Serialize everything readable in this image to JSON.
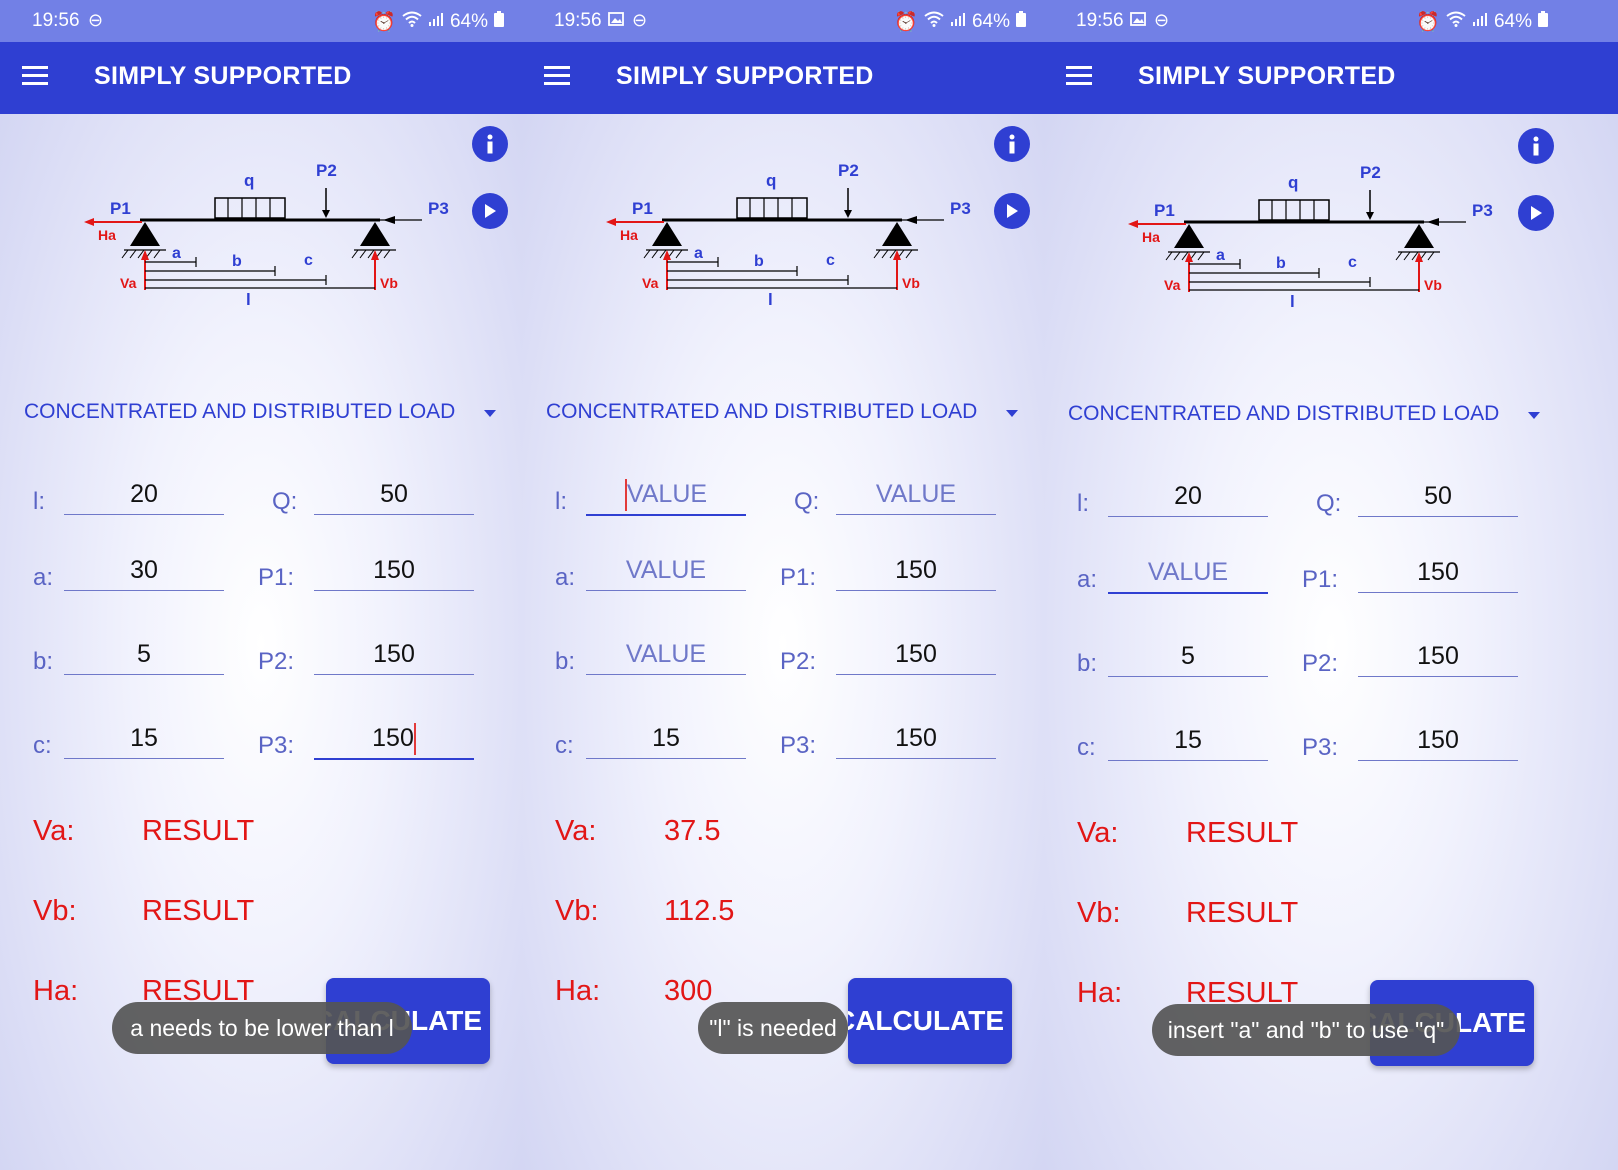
{
  "app": {
    "title": "SIMPLY SUPPORTED"
  },
  "status": {
    "time": "19:56",
    "battery": "64%"
  },
  "load_type": "CONCENTRATED AND DISTRIBUTED LOAD",
  "diagram": {
    "P1": "P1",
    "P2": "P2",
    "P3": "P3",
    "q": "q",
    "Ha": "Ha",
    "Va": "Va",
    "Vb": "Vb",
    "a": "a",
    "b": "b",
    "c": "c",
    "l": "l"
  },
  "labels": {
    "l": "l:",
    "a": "a:",
    "b": "b:",
    "c": "c:",
    "Q": "Q:",
    "P1": "P1:",
    "P2": "P2:",
    "P3": "P3:",
    "Va": "Va:",
    "Vb": "Vb:",
    "Ha": "Ha:"
  },
  "calculate_label": "CALCULATE",
  "screens": [
    {
      "inputs": {
        "l": "20",
        "Q": "50",
        "a": "30",
        "P1": "150",
        "b": "5",
        "P2": "150",
        "c": "15",
        "P3": "150"
      },
      "results": {
        "Va": "RESULT",
        "Vb": "RESULT",
        "Ha": "RESULT"
      },
      "toast": "a needs to be lower than l"
    },
    {
      "inputs": {
        "l": "VALUE",
        "Q": "VALUE",
        "a": "VALUE",
        "P1": "150",
        "b": "VALUE",
        "P2": "150",
        "c": "15",
        "P3": "150"
      },
      "results": {
        "Va": "37.5",
        "Vb": "112.5",
        "Ha": "300"
      },
      "toast": "\"l\" is needed"
    },
    {
      "inputs": {
        "l": "20",
        "Q": "50",
        "a": "VALUE",
        "P1": "150",
        "b": "5",
        "P2": "150",
        "c": "15",
        "P3": "150"
      },
      "results": {
        "Va": "RESULT",
        "Vb": "RESULT",
        "Ha": "RESULT"
      },
      "toast": "insert \"a\" and \"b\" to use \"q\""
    }
  ],
  "colors": {
    "primary": "#2f3fd2",
    "result": "#e21616",
    "status_bar": "#7280e6"
  },
  "icons": [
    "menu-icon",
    "info-icon",
    "play-icon",
    "alarm-icon",
    "wifi-icon",
    "signal-icon",
    "battery-icon",
    "gallery-icon",
    "dnd-icon"
  ]
}
